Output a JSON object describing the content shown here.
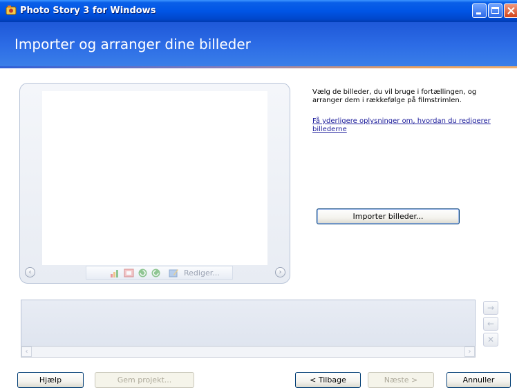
{
  "window": {
    "title": "Photo Story 3 for Windows",
    "icon": "app-icon"
  },
  "header": {
    "heading": "Importer og arranger dine billeder"
  },
  "viewer": {
    "toolbar": {
      "edit_label": "Rediger..."
    }
  },
  "instructions": {
    "text": "Vælg de billeder, du vil bruge i fortællingen, og arranger dem i rækkefølge på filmstrimlen.",
    "link": "Få yderligere oplysninger om, hvordan du redigerer billederne"
  },
  "import_button": "Importer billeder...",
  "filmstrip": {
    "side_buttons": [
      "→",
      "←",
      "✕"
    ]
  },
  "footer": {
    "help": "Hjælp",
    "save_project": "Gem projekt...",
    "back": "< Tilbage",
    "next": "Næste >",
    "cancel": "Annuller"
  },
  "colors": {
    "titlebar": "#0055e5",
    "banner": "#2d6de6",
    "accent_line": "#e8a060"
  }
}
